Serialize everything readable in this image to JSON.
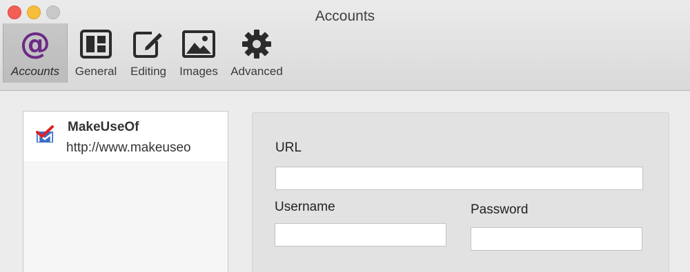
{
  "window": {
    "title": "Accounts"
  },
  "toolbar": {
    "items": [
      {
        "label": "Accounts",
        "icon": "at-icon",
        "selected": true
      },
      {
        "label": "General",
        "icon": "columns-icon",
        "selected": false
      },
      {
        "label": "Editing",
        "icon": "edit-icon",
        "selected": false
      },
      {
        "label": "Images",
        "icon": "image-icon",
        "selected": false
      },
      {
        "label": "Advanced",
        "icon": "gear-icon",
        "selected": false
      }
    ]
  },
  "accounts": [
    {
      "name": "MakeUseOf",
      "url": "http://www.makeuseo",
      "icon": "makeuseof-logo-icon"
    }
  ],
  "form": {
    "url_label": "URL",
    "url_value": "",
    "username_label": "Username",
    "username_value": "",
    "password_label": "Password",
    "password_value": ""
  },
  "colors": {
    "accent_at": "#6b2a86",
    "close": "#f45e55",
    "minimize": "#f7be3b",
    "maximize": "#c9c9c9"
  }
}
